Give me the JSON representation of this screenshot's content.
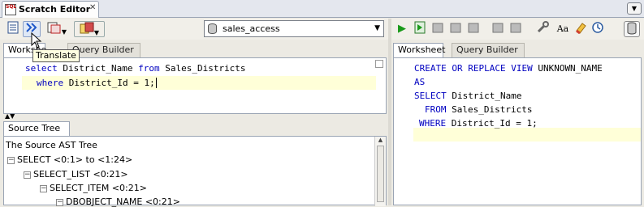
{
  "window": {
    "tab_title": "Scratch Editor",
    "tab_close": "✕",
    "menu_button": "▼"
  },
  "toolbar_left": {
    "connection_value": "sales_access",
    "tooltip": "Translate"
  },
  "left_tabs": {
    "worksheet": "Workshe",
    "query_builder": "Query Builder"
  },
  "left_code": {
    "line1_kw1": "select",
    "line1_mid": " District_Name ",
    "line1_kw2": "from",
    "line1_end": " Sales_Districts",
    "line2_kw": "where",
    "line2_end": " District_Id = 1;"
  },
  "source_tree": {
    "tab_label": "Source Tree",
    "tab_close": "✕",
    "root": "The Source AST Tree",
    "nodes": [
      "SELECT <0:1> to <1:24>",
      "SELECT_LIST <0:21>",
      "SELECT_ITEM <0:21>",
      "DBOBJECT_NAME <0:21>"
    ]
  },
  "right_tabs": {
    "worksheet": "Worksheet",
    "query_builder": "Query Builder"
  },
  "right_code": {
    "line1_kw": "CREATE OR REPLACE VIEW",
    "line1_end": " UNKNOWN_NAME",
    "line2_kw": "AS",
    "line3_kw": "SELECT",
    "line3_end": " District_Name",
    "line4_kw": "FROM",
    "line4_end": " Sales_Districts",
    "line5_kw": "WHERE",
    "line5_end": " District_Id = 1;"
  }
}
